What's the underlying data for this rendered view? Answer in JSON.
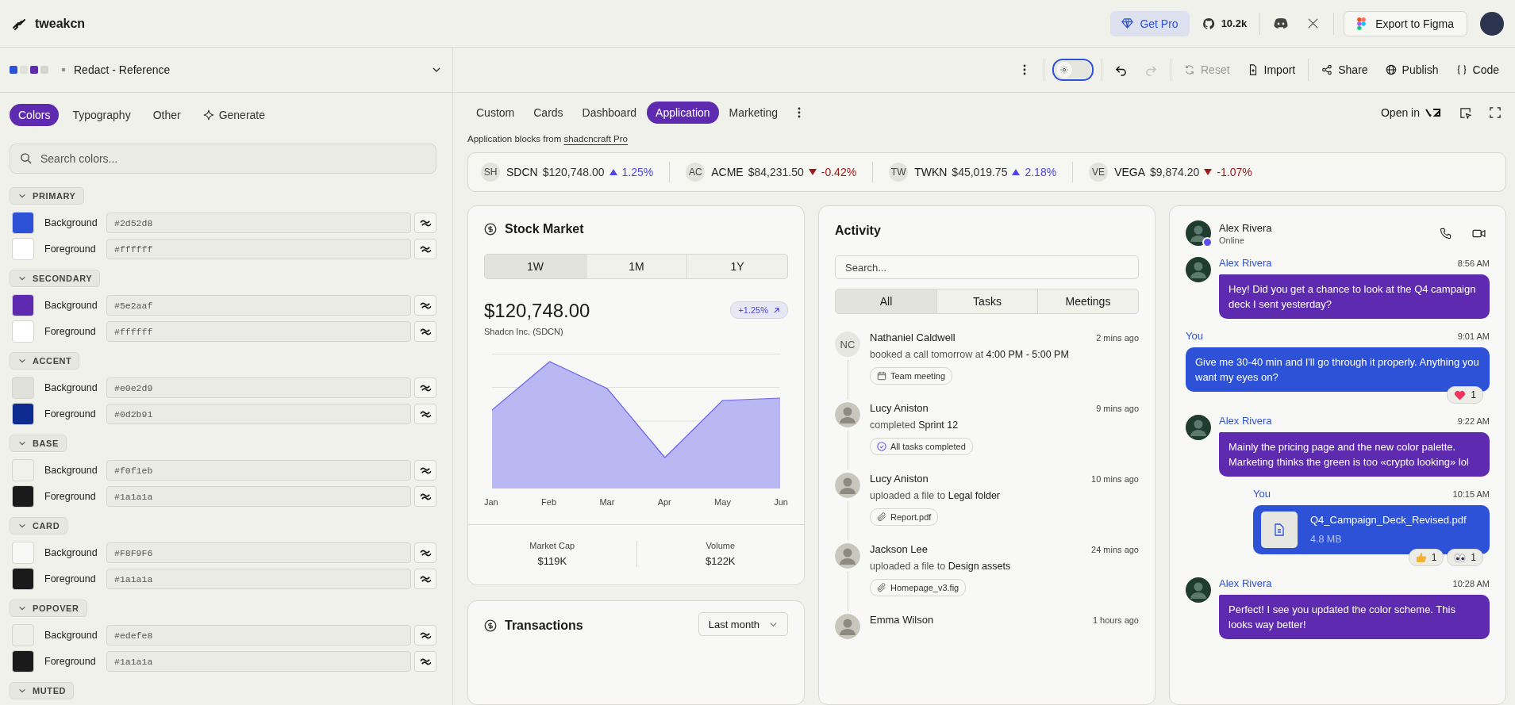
{
  "header": {
    "app_name": "tweakcn",
    "get_pro": "Get Pro",
    "github_stars": "10.2k",
    "export_button": "Export to Figma"
  },
  "preset_bar": {
    "swatches": [
      {
        "color": "#2d52d8"
      },
      {
        "color": "#e0e2d9"
      },
      {
        "color": "#5e2aaf"
      },
      {
        "color": "#d4d4cf"
      }
    ],
    "preset": "Redact - Reference"
  },
  "toolbar": {
    "dark_mode": false,
    "history": [
      {
        "kind": "undo",
        "disabled": false
      },
      {
        "kind": "redo",
        "disabled": true
      }
    ],
    "file_actions": [
      {
        "kind": "reset",
        "label": "Reset",
        "disabled": true
      },
      {
        "kind": "import",
        "label": "Import",
        "disabled": false
      }
    ],
    "share_actions": [
      {
        "kind": "share",
        "label": "Share"
      },
      {
        "kind": "publish",
        "label": "Publish"
      },
      {
        "kind": "code",
        "label": "Code"
      }
    ]
  },
  "editor_tabs": [
    {
      "kind": "text",
      "label": "Colors",
      "selected": true
    },
    {
      "kind": "text",
      "label": "Typography",
      "selected": false
    },
    {
      "kind": "text",
      "label": "Other",
      "selected": false
    },
    {
      "kind": "generate",
      "label": "Generate",
      "selected": false
    }
  ],
  "color_search": {
    "placeholder": "Search colors..."
  },
  "color_groups": [
    {
      "name": "PRIMARY",
      "expanded": true,
      "tokens": [
        {
          "label": "Background",
          "value": "#2d52d8",
          "color": "#2d52d8"
        },
        {
          "label": "Foreground",
          "value": "#ffffff",
          "color": "#ffffff"
        }
      ]
    },
    {
      "name": "SECONDARY",
      "expanded": true,
      "tokens": [
        {
          "label": "Background",
          "value": "#5e2aaf",
          "color": "#5e2aaf"
        },
        {
          "label": "Foreground",
          "value": "#ffffff",
          "color": "#ffffff"
        }
      ]
    },
    {
      "name": "ACCENT",
      "expanded": true,
      "tokens": [
        {
          "label": "Background",
          "value": "#e0e2d9",
          "color": "#e0e2d9"
        },
        {
          "label": "Foreground",
          "value": "#0d2b91",
          "color": "#0d2b91"
        }
      ]
    },
    {
      "name": "BASE",
      "expanded": true,
      "tokens": [
        {
          "label": "Background",
          "value": "#f0f1eb",
          "color": "#f0f1eb"
        },
        {
          "label": "Foreground",
          "value": "#1a1a1a",
          "color": "#1a1a1a"
        }
      ]
    },
    {
      "name": "CARD",
      "expanded": true,
      "tokens": [
        {
          "label": "Background",
          "value": "#F8F9F6",
          "color": "#f8f9f6"
        },
        {
          "label": "Foreground",
          "value": "#1a1a1a",
          "color": "#1a1a1a"
        }
      ]
    },
    {
      "name": "POPOVER",
      "expanded": true,
      "tokens": [
        {
          "label": "Background",
          "value": "#edefe8",
          "color": "#edefe8"
        },
        {
          "label": "Foreground",
          "value": "#1a1a1a",
          "color": "#1a1a1a"
        }
      ]
    },
    {
      "name": "MUTED",
      "expanded": true
    }
  ],
  "preview": {
    "tabs": [
      {
        "label": "Custom",
        "selected": false
      },
      {
        "label": "Cards",
        "selected": false
      },
      {
        "label": "Dashboard",
        "selected": false
      },
      {
        "label": "Application",
        "selected": true
      },
      {
        "label": "Marketing",
        "selected": false
      }
    ],
    "open_in": "Open in",
    "source_text": "Application blocks from",
    "source_link": "shadcncraft Pro"
  },
  "ticker": [
    {
      "initials": "SH",
      "symbol": "SDCN",
      "price": "$120,748.00",
      "change": "1.25%",
      "kind": "up"
    },
    {
      "initials": "AC",
      "symbol": "ACME",
      "price": "$84,231.50",
      "change": "-0.42%",
      "kind": "down"
    },
    {
      "initials": "TW",
      "symbol": "TWKN",
      "price": "$45,019.75",
      "change": "2.18%",
      "kind": "up"
    },
    {
      "initials": "VE",
      "symbol": "VEGA",
      "price": "$9,874.20",
      "change": "-1.07%",
      "kind": "down"
    }
  ],
  "stock_card": {
    "title": "Stock Market",
    "ranges": [
      {
        "label": "1W",
        "selected": true
      },
      {
        "label": "1M",
        "selected": false
      },
      {
        "label": "1Y",
        "selected": false
      }
    ],
    "price": "$120,748.00",
    "company": "Shadcn Inc. (SDCN)",
    "change": "+1.25%",
    "months": [
      "Jan",
      "Feb",
      "Mar",
      "Apr",
      "May",
      "Jun"
    ],
    "stats": [
      {
        "label": "Market Cap",
        "value": "$119K"
      },
      {
        "label": "Volume",
        "value": "$122K"
      }
    ]
  },
  "transactions_card": {
    "title": "Transactions",
    "period": "Last month"
  },
  "activity": {
    "title": "Activity",
    "search_placeholder": "Search...",
    "filters": [
      {
        "label": "All",
        "selected": true
      },
      {
        "label": "Tasks",
        "selected": false
      },
      {
        "label": "Meetings",
        "selected": false
      }
    ],
    "items": [
      {
        "name": "Nathaniel Caldwell",
        "avatar": {
          "kind": "initials",
          "text": "NC"
        },
        "time": "2 mins ago",
        "text": "booked a call tomorrow at **4:00 PM - 5:00 PM**",
        "tag": {
          "kind": "calendar",
          "label": "Team meeting"
        }
      },
      {
        "name": "Lucy Aniston",
        "avatar": {
          "kind": "photo"
        },
        "time": "9 mins ago",
        "text": "completed **Sprint 12**",
        "tag": {
          "kind": "check",
          "label": "All tasks completed"
        }
      },
      {
        "name": "Lucy Aniston",
        "avatar": {
          "kind": "photo"
        },
        "time": "10 mins ago",
        "text": "uploaded a file to **Legal folder**",
        "tag": {
          "kind": "attachment",
          "label": "Report.pdf"
        }
      },
      {
        "name": "Jackson Lee",
        "avatar": {
          "kind": "photo"
        },
        "time": "24 mins ago",
        "text": "uploaded a file to **Design assets**",
        "tag": {
          "kind": "attachment",
          "label": "Homepage_v3.fig"
        }
      },
      {
        "name": "Emma Wilson",
        "avatar": {
          "kind": "photo"
        },
        "time": "1 hours ago"
      }
    ]
  },
  "chat": {
    "contact": "Alex Rivera",
    "status": "Online",
    "online": true,
    "messages": [
      {
        "kind": "incoming",
        "name": "Alex Rivera",
        "time": "8:56 AM",
        "text": "Hey! Did you get a chance to look at the Q4 campaign deck I sent yesterday?"
      },
      {
        "kind": "outgoing",
        "name": "You",
        "time": "9:01 AM",
        "text": "Give me 30-40 min and I'll go through it properly. Anything you want my eyes on?",
        "reactions": [
          {
            "kind": "heart",
            "count": "1"
          }
        ]
      },
      {
        "kind": "incoming",
        "name": "Alex Rivera",
        "time": "9:22 AM",
        "text": "Mainly the pricing page and the new color palette. Marketing thinks the green is too «crypto looking» lol"
      },
      {
        "kind": "outgoing_file",
        "name": "You",
        "time": "10:15 AM",
        "file_name": "Q4_Campaign_Deck_Revised.pdf",
        "file_size": "4.8 MB",
        "reactions": [
          {
            "kind": "thumbs_up",
            "count": "1"
          },
          {
            "kind": "eyes",
            "count": "1"
          }
        ]
      },
      {
        "kind": "incoming",
        "name": "Alex Rivera",
        "time": "10:28 AM",
        "text": "Perfect! I see you updated the color scheme. This looks way better!"
      }
    ]
  }
}
